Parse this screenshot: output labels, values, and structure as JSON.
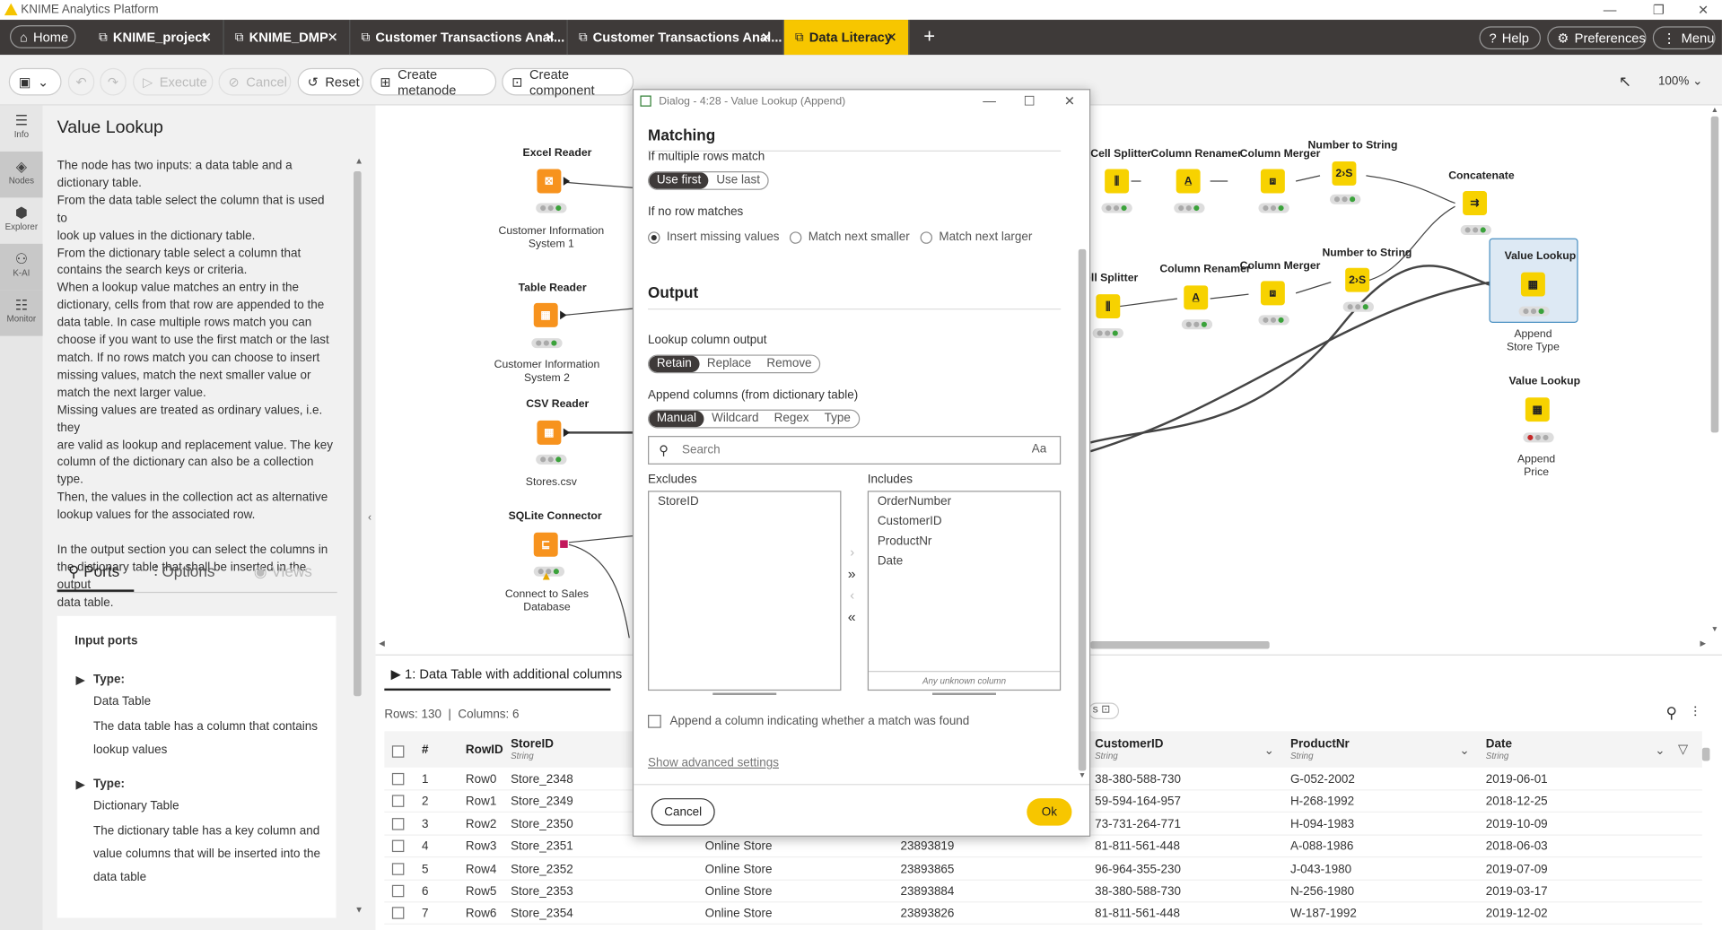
{
  "app": {
    "title": "KNIME Analytics Platform"
  },
  "tabs": [
    {
      "label": "Home"
    },
    {
      "label": "KNIME_project"
    },
    {
      "label": "KNIME_DMP"
    },
    {
      "label": "Customer Transactions Anal..."
    },
    {
      "label": "Customer Transactions Anal..."
    },
    {
      "label": "Data Literacy"
    }
  ],
  "topright": {
    "help": "Help",
    "preferences": "Preferences",
    "menu": "Menu"
  },
  "toolbar": {
    "execute": "Execute",
    "cancel": "Cancel",
    "reset": "Reset",
    "metanode": "Create metanode",
    "component": "Create component",
    "zoom": "100%"
  },
  "rail": [
    {
      "label": "Info",
      "icon": "info-icon"
    },
    {
      "label": "Nodes",
      "icon": "nodes-icon"
    },
    {
      "label": "Explorer",
      "icon": "explorer-icon"
    },
    {
      "label": "K-AI",
      "icon": "kai-icon"
    },
    {
      "label": "Monitor",
      "icon": "monitor-icon"
    }
  ],
  "side": {
    "title": "Value Lookup",
    "desc": [
      "The node has two inputs: a data table and a",
      "dictionary table.",
      "From the data table select the column that is used to",
      "look up values in the dictionary table.",
      "From the dictionary table select a column that",
      "contains the search keys or criteria.",
      "When a lookup value matches an entry in the",
      "dictionary, cells from that row are appended to the",
      "data table. In case multiple rows match you can",
      "choose if you want to use the first match or the last",
      "match. If no rows match you can choose to insert",
      "missing values, match the next smaller value or",
      "match the next larger value.",
      "Missing values are treated as ordinary values, i.e. they",
      "are valid as lookup and replacement value. The key",
      "column of the dictionary can also be a collection type.",
      "Then, the values in the collection act as alternative",
      "lookup values for the associated row.",
      "",
      "In the output section you can select the columns in",
      "the dictionary table that shall be inserted in the output",
      "data table."
    ],
    "tab_ports": "Ports",
    "tab_options": "Options",
    "tab_views": "Views",
    "input_ports": "Input ports",
    "type_label": "Type:",
    "port1_type": "Data Table",
    "port1_desc1": "The data table has a column that contains",
    "port1_desc2": "lookup values",
    "port2_type": "Dictionary Table",
    "port2_desc1": "The dictionary table has a key column and",
    "port2_desc2": "value columns that will be inserted into the",
    "port2_desc3": "data table"
  },
  "nodes": {
    "excel_title": "Excel Reader",
    "excel_label1": "Customer Information",
    "excel_label2": "System 1",
    "table_title": "Table Reader",
    "table_label1": "Customer Information",
    "table_label2": "System 2",
    "csv_title": "CSV Reader",
    "csv_label": "Stores.csv",
    "sqlite_title": "SQLite Connector",
    "sqlite_label1": "Connect to Sales",
    "sqlite_label2": "Database",
    "cellsplit1": "Cell Splitter",
    "renamer1": "Column Renamer",
    "merger1": "Column Merger",
    "numstr1": "Number to String",
    "concat": "Concatenate",
    "cellsplit2": "ell Splitter",
    "renamer2": "Column Renamer",
    "merger2": "Column Merger",
    "numstr2": "Number to String",
    "vl1_title": "Value Lookup",
    "vl1_label1": "Append",
    "vl1_label2": "Store Type",
    "vl2_title": "Value Lookup",
    "vl2_label1": "Append",
    "vl2_label2": "Price"
  },
  "table": {
    "tab": "1: Data Table with additional columns",
    "rows": "Rows: 130",
    "cols": "Columns: 6",
    "headers": {
      "num": "#",
      "rowid": "RowID",
      "storeid": "StoreID",
      "customerid": "CustomerID",
      "productnr": "ProductNr",
      "date": "Date",
      "type": "String"
    },
    "data": [
      {
        "n": "1",
        "id": "Row0",
        "store": "Store_2348",
        "ch": "",
        "ord": "",
        "cust": "38-380-588-730",
        "prod": "G-052-2002",
        "date": "2019-06-01"
      },
      {
        "n": "2",
        "id": "Row1",
        "store": "Store_2349",
        "ch": "",
        "ord": "",
        "cust": "59-594-164-957",
        "prod": "H-268-1992",
        "date": "2018-12-25"
      },
      {
        "n": "3",
        "id": "Row2",
        "store": "Store_2350",
        "ch": "",
        "ord": "",
        "cust": "73-731-264-771",
        "prod": "H-094-1983",
        "date": "2019-10-09"
      },
      {
        "n": "4",
        "id": "Row3",
        "store": "Store_2351",
        "ch": "Online Store",
        "ord": "23893819",
        "cust": "81-811-561-448",
        "prod": "A-088-1986",
        "date": "2018-06-03"
      },
      {
        "n": "5",
        "id": "Row4",
        "store": "Store_2352",
        "ch": "Online Store",
        "ord": "23893865",
        "cust": "96-964-355-230",
        "prod": "J-043-1980",
        "date": "2019-07-09"
      },
      {
        "n": "6",
        "id": "Row5",
        "store": "Store_2353",
        "ch": "Online Store",
        "ord": "23893884",
        "cust": "38-380-588-730",
        "prod": "N-256-1980",
        "date": "2019-03-17"
      },
      {
        "n": "7",
        "id": "Row6",
        "store": "Store_2354",
        "ch": "Online Store",
        "ord": "23893826",
        "cust": "81-811-561-448",
        "prod": "W-187-1992",
        "date": "2019-12-02"
      }
    ]
  },
  "dialog": {
    "title": "Dialog - 4:28 - Value Lookup (Append)",
    "matching": "Matching",
    "multiple": "If multiple rows match",
    "use_first": "Use first",
    "use_last": "Use last",
    "no_match": "If no row matches",
    "insert_missing": "Insert missing values",
    "next_smaller": "Match next smaller",
    "next_larger": "Match next larger",
    "output": "Output",
    "lookup_out": "Lookup column output",
    "retain": "Retain",
    "replace": "Replace",
    "remove": "Remove",
    "append_cols": "Append columns (from dictionary table)",
    "manual": "Manual",
    "wildcard": "Wildcard",
    "regex": "Regex",
    "type": "Type",
    "search_placeholder": "Search",
    "case": "Aa",
    "excludes": "Excludes",
    "includes": "Includes",
    "excl_items": [
      "StoreID"
    ],
    "incl_items": [
      "OrderNumber",
      "CustomerID",
      "ProductNr",
      "Date"
    ],
    "unknown": "Any unknown column",
    "append_found": "Append a column indicating whether a match was found",
    "advanced": "Show advanced settings",
    "cancel": "Cancel",
    "ok": "Ok"
  }
}
